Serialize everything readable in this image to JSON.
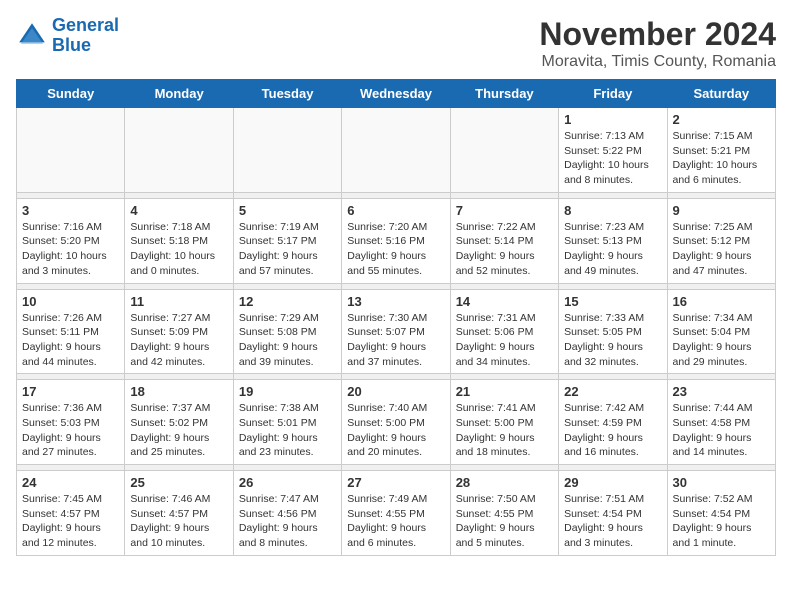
{
  "logo": {
    "line1": "General",
    "line2": "Blue"
  },
  "title": "November 2024",
  "location": "Moravita, Timis County, Romania",
  "weekdays": [
    "Sunday",
    "Monday",
    "Tuesday",
    "Wednesday",
    "Thursday",
    "Friday",
    "Saturday"
  ],
  "weeks": [
    [
      {
        "day": "",
        "info": ""
      },
      {
        "day": "",
        "info": ""
      },
      {
        "day": "",
        "info": ""
      },
      {
        "day": "",
        "info": ""
      },
      {
        "day": "",
        "info": ""
      },
      {
        "day": "1",
        "info": "Sunrise: 7:13 AM\nSunset: 5:22 PM\nDaylight: 10 hours and 8 minutes."
      },
      {
        "day": "2",
        "info": "Sunrise: 7:15 AM\nSunset: 5:21 PM\nDaylight: 10 hours and 6 minutes."
      }
    ],
    [
      {
        "day": "3",
        "info": "Sunrise: 7:16 AM\nSunset: 5:20 PM\nDaylight: 10 hours and 3 minutes."
      },
      {
        "day": "4",
        "info": "Sunrise: 7:18 AM\nSunset: 5:18 PM\nDaylight: 10 hours and 0 minutes."
      },
      {
        "day": "5",
        "info": "Sunrise: 7:19 AM\nSunset: 5:17 PM\nDaylight: 9 hours and 57 minutes."
      },
      {
        "day": "6",
        "info": "Sunrise: 7:20 AM\nSunset: 5:16 PM\nDaylight: 9 hours and 55 minutes."
      },
      {
        "day": "7",
        "info": "Sunrise: 7:22 AM\nSunset: 5:14 PM\nDaylight: 9 hours and 52 minutes."
      },
      {
        "day": "8",
        "info": "Sunrise: 7:23 AM\nSunset: 5:13 PM\nDaylight: 9 hours and 49 minutes."
      },
      {
        "day": "9",
        "info": "Sunrise: 7:25 AM\nSunset: 5:12 PM\nDaylight: 9 hours and 47 minutes."
      }
    ],
    [
      {
        "day": "10",
        "info": "Sunrise: 7:26 AM\nSunset: 5:11 PM\nDaylight: 9 hours and 44 minutes."
      },
      {
        "day": "11",
        "info": "Sunrise: 7:27 AM\nSunset: 5:09 PM\nDaylight: 9 hours and 42 minutes."
      },
      {
        "day": "12",
        "info": "Sunrise: 7:29 AM\nSunset: 5:08 PM\nDaylight: 9 hours and 39 minutes."
      },
      {
        "day": "13",
        "info": "Sunrise: 7:30 AM\nSunset: 5:07 PM\nDaylight: 9 hours and 37 minutes."
      },
      {
        "day": "14",
        "info": "Sunrise: 7:31 AM\nSunset: 5:06 PM\nDaylight: 9 hours and 34 minutes."
      },
      {
        "day": "15",
        "info": "Sunrise: 7:33 AM\nSunset: 5:05 PM\nDaylight: 9 hours and 32 minutes."
      },
      {
        "day": "16",
        "info": "Sunrise: 7:34 AM\nSunset: 5:04 PM\nDaylight: 9 hours and 29 minutes."
      }
    ],
    [
      {
        "day": "17",
        "info": "Sunrise: 7:36 AM\nSunset: 5:03 PM\nDaylight: 9 hours and 27 minutes."
      },
      {
        "day": "18",
        "info": "Sunrise: 7:37 AM\nSunset: 5:02 PM\nDaylight: 9 hours and 25 minutes."
      },
      {
        "day": "19",
        "info": "Sunrise: 7:38 AM\nSunset: 5:01 PM\nDaylight: 9 hours and 23 minutes."
      },
      {
        "day": "20",
        "info": "Sunrise: 7:40 AM\nSunset: 5:00 PM\nDaylight: 9 hours and 20 minutes."
      },
      {
        "day": "21",
        "info": "Sunrise: 7:41 AM\nSunset: 5:00 PM\nDaylight: 9 hours and 18 minutes."
      },
      {
        "day": "22",
        "info": "Sunrise: 7:42 AM\nSunset: 4:59 PM\nDaylight: 9 hours and 16 minutes."
      },
      {
        "day": "23",
        "info": "Sunrise: 7:44 AM\nSunset: 4:58 PM\nDaylight: 9 hours and 14 minutes."
      }
    ],
    [
      {
        "day": "24",
        "info": "Sunrise: 7:45 AM\nSunset: 4:57 PM\nDaylight: 9 hours and 12 minutes."
      },
      {
        "day": "25",
        "info": "Sunrise: 7:46 AM\nSunset: 4:57 PM\nDaylight: 9 hours and 10 minutes."
      },
      {
        "day": "26",
        "info": "Sunrise: 7:47 AM\nSunset: 4:56 PM\nDaylight: 9 hours and 8 minutes."
      },
      {
        "day": "27",
        "info": "Sunrise: 7:49 AM\nSunset: 4:55 PM\nDaylight: 9 hours and 6 minutes."
      },
      {
        "day": "28",
        "info": "Sunrise: 7:50 AM\nSunset: 4:55 PM\nDaylight: 9 hours and 5 minutes."
      },
      {
        "day": "29",
        "info": "Sunrise: 7:51 AM\nSunset: 4:54 PM\nDaylight: 9 hours and 3 minutes."
      },
      {
        "day": "30",
        "info": "Sunrise: 7:52 AM\nSunset: 4:54 PM\nDaylight: 9 hours and 1 minute."
      }
    ]
  ]
}
